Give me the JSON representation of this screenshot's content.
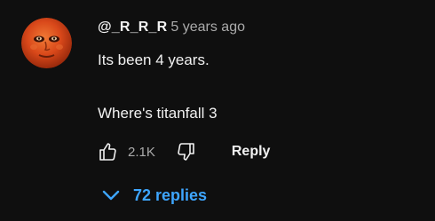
{
  "comment": {
    "author": "@_R_R_R",
    "timestamp": "5 years ago",
    "lines": [
      "Its been 4 years.",
      "Where's titanfall 3"
    ],
    "like_count": "2.1K",
    "reply_label": "Reply",
    "replies_label": "72 replies"
  },
  "icons": {
    "like": "thumbs-up-icon",
    "dislike": "thumbs-down-icon",
    "expand": "chevron-down-icon"
  },
  "colors": {
    "background": "#0f0f0f",
    "text": "#f1f1f1",
    "muted": "#aaaaaa",
    "link": "#3ea6ff"
  }
}
